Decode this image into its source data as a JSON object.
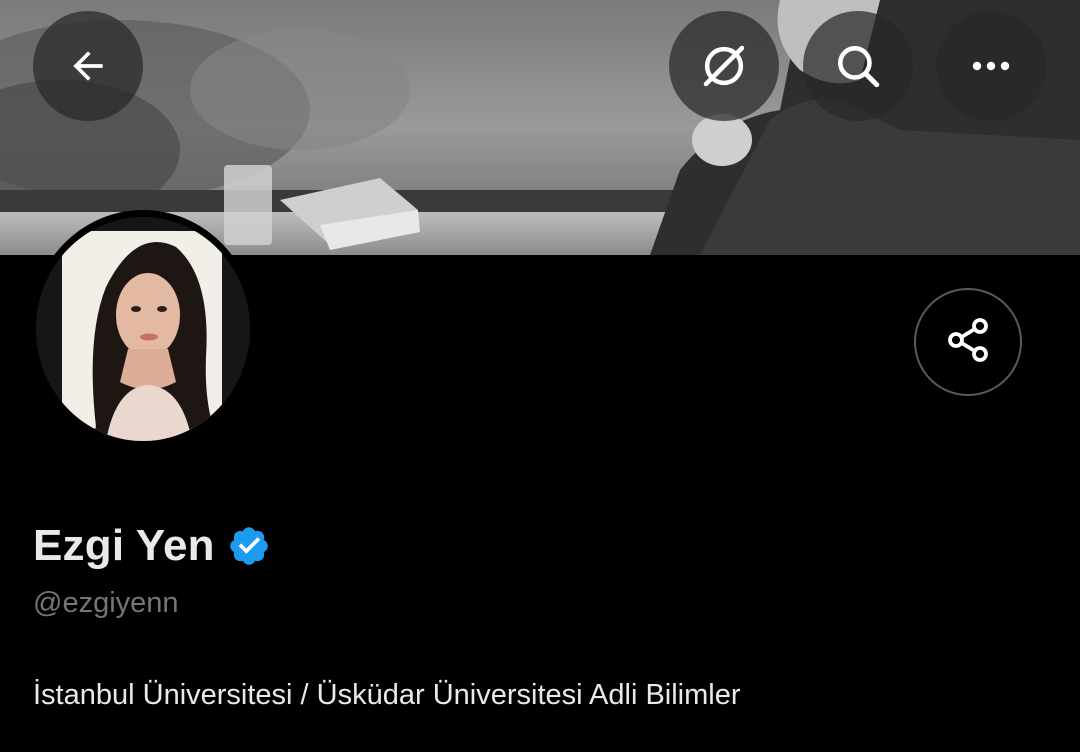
{
  "header": {
    "back_icon": "arrow-left-icon",
    "grok_icon": "grok-icon",
    "search_icon": "search-icon",
    "more_icon": "more-horizontal-icon"
  },
  "profile": {
    "display_name": "Ezgi Yen",
    "verified": true,
    "verified_color": "#1d9bf0",
    "handle": "@ezgiyenn",
    "bio": "İstanbul Üniversitesi / Üsküdar Üniversitesi Adli Bilimler",
    "share_icon": "share-icon"
  },
  "colors": {
    "background": "#000000",
    "primary_text": "#e7e9ea",
    "secondary_text": "#71767b",
    "accent": "#1d9bf0"
  }
}
